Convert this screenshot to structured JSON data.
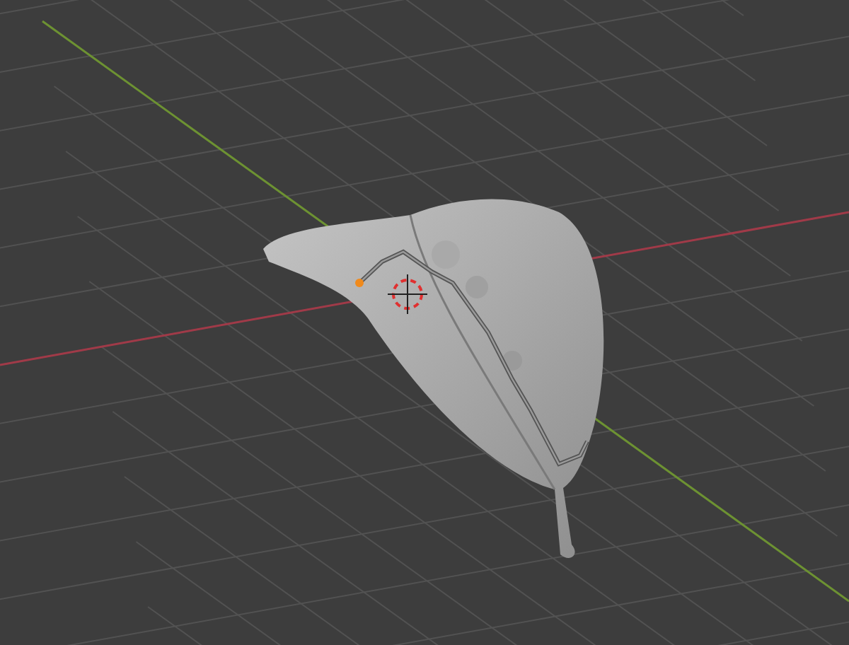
{
  "viewport": {
    "axes": [
      {
        "kind": "x",
        "color": "#a03a48"
      },
      {
        "kind": "y",
        "color": "#6d9232"
      }
    ]
  }
}
